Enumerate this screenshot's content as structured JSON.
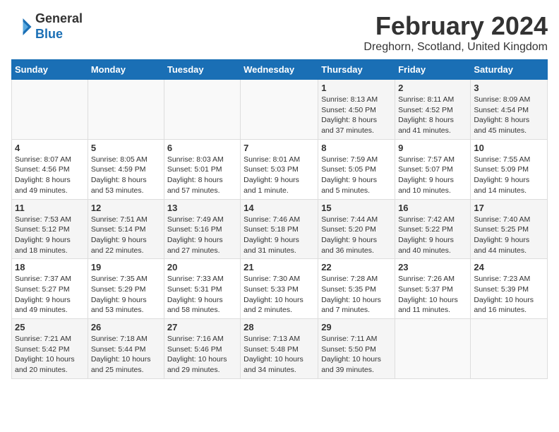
{
  "header": {
    "logo_line1": "General",
    "logo_line2": "Blue",
    "month_year": "February 2024",
    "location": "Dreghorn, Scotland, United Kingdom"
  },
  "days_of_week": [
    "Sunday",
    "Monday",
    "Tuesday",
    "Wednesday",
    "Thursday",
    "Friday",
    "Saturday"
  ],
  "weeks": [
    [
      {
        "day": "",
        "info": ""
      },
      {
        "day": "",
        "info": ""
      },
      {
        "day": "",
        "info": ""
      },
      {
        "day": "",
        "info": ""
      },
      {
        "day": "1",
        "info": "Sunrise: 8:13 AM\nSunset: 4:50 PM\nDaylight: 8 hours\nand 37 minutes."
      },
      {
        "day": "2",
        "info": "Sunrise: 8:11 AM\nSunset: 4:52 PM\nDaylight: 8 hours\nand 41 minutes."
      },
      {
        "day": "3",
        "info": "Sunrise: 8:09 AM\nSunset: 4:54 PM\nDaylight: 8 hours\nand 45 minutes."
      }
    ],
    [
      {
        "day": "4",
        "info": "Sunrise: 8:07 AM\nSunset: 4:56 PM\nDaylight: 8 hours\nand 49 minutes."
      },
      {
        "day": "5",
        "info": "Sunrise: 8:05 AM\nSunset: 4:59 PM\nDaylight: 8 hours\nand 53 minutes."
      },
      {
        "day": "6",
        "info": "Sunrise: 8:03 AM\nSunset: 5:01 PM\nDaylight: 8 hours\nand 57 minutes."
      },
      {
        "day": "7",
        "info": "Sunrise: 8:01 AM\nSunset: 5:03 PM\nDaylight: 9 hours\nand 1 minute."
      },
      {
        "day": "8",
        "info": "Sunrise: 7:59 AM\nSunset: 5:05 PM\nDaylight: 9 hours\nand 5 minutes."
      },
      {
        "day": "9",
        "info": "Sunrise: 7:57 AM\nSunset: 5:07 PM\nDaylight: 9 hours\nand 10 minutes."
      },
      {
        "day": "10",
        "info": "Sunrise: 7:55 AM\nSunset: 5:09 PM\nDaylight: 9 hours\nand 14 minutes."
      }
    ],
    [
      {
        "day": "11",
        "info": "Sunrise: 7:53 AM\nSunset: 5:12 PM\nDaylight: 9 hours\nand 18 minutes."
      },
      {
        "day": "12",
        "info": "Sunrise: 7:51 AM\nSunset: 5:14 PM\nDaylight: 9 hours\nand 22 minutes."
      },
      {
        "day": "13",
        "info": "Sunrise: 7:49 AM\nSunset: 5:16 PM\nDaylight: 9 hours\nand 27 minutes."
      },
      {
        "day": "14",
        "info": "Sunrise: 7:46 AM\nSunset: 5:18 PM\nDaylight: 9 hours\nand 31 minutes."
      },
      {
        "day": "15",
        "info": "Sunrise: 7:44 AM\nSunset: 5:20 PM\nDaylight: 9 hours\nand 36 minutes."
      },
      {
        "day": "16",
        "info": "Sunrise: 7:42 AM\nSunset: 5:22 PM\nDaylight: 9 hours\nand 40 minutes."
      },
      {
        "day": "17",
        "info": "Sunrise: 7:40 AM\nSunset: 5:25 PM\nDaylight: 9 hours\nand 44 minutes."
      }
    ],
    [
      {
        "day": "18",
        "info": "Sunrise: 7:37 AM\nSunset: 5:27 PM\nDaylight: 9 hours\nand 49 minutes."
      },
      {
        "day": "19",
        "info": "Sunrise: 7:35 AM\nSunset: 5:29 PM\nDaylight: 9 hours\nand 53 minutes."
      },
      {
        "day": "20",
        "info": "Sunrise: 7:33 AM\nSunset: 5:31 PM\nDaylight: 9 hours\nand 58 minutes."
      },
      {
        "day": "21",
        "info": "Sunrise: 7:30 AM\nSunset: 5:33 PM\nDaylight: 10 hours\nand 2 minutes."
      },
      {
        "day": "22",
        "info": "Sunrise: 7:28 AM\nSunset: 5:35 PM\nDaylight: 10 hours\nand 7 minutes."
      },
      {
        "day": "23",
        "info": "Sunrise: 7:26 AM\nSunset: 5:37 PM\nDaylight: 10 hours\nand 11 minutes."
      },
      {
        "day": "24",
        "info": "Sunrise: 7:23 AM\nSunset: 5:39 PM\nDaylight: 10 hours\nand 16 minutes."
      }
    ],
    [
      {
        "day": "25",
        "info": "Sunrise: 7:21 AM\nSunset: 5:42 PM\nDaylight: 10 hours\nand 20 minutes."
      },
      {
        "day": "26",
        "info": "Sunrise: 7:18 AM\nSunset: 5:44 PM\nDaylight: 10 hours\nand 25 minutes."
      },
      {
        "day": "27",
        "info": "Sunrise: 7:16 AM\nSunset: 5:46 PM\nDaylight: 10 hours\nand 29 minutes."
      },
      {
        "day": "28",
        "info": "Sunrise: 7:13 AM\nSunset: 5:48 PM\nDaylight: 10 hours\nand 34 minutes."
      },
      {
        "day": "29",
        "info": "Sunrise: 7:11 AM\nSunset: 5:50 PM\nDaylight: 10 hours\nand 39 minutes."
      },
      {
        "day": "",
        "info": ""
      },
      {
        "day": "",
        "info": ""
      }
    ]
  ]
}
